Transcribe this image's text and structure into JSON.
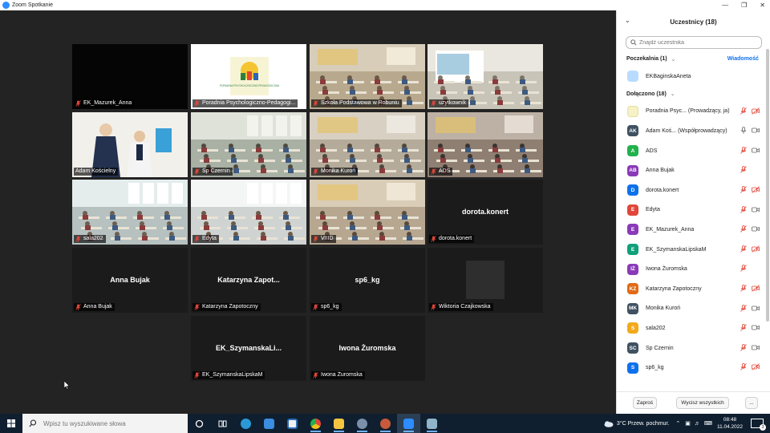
{
  "window": {
    "title": "Zoom Spotkanie"
  },
  "tiles": [
    {
      "name": "EK_Mazurek_Anna",
      "kind": "black"
    },
    {
      "name": "Poradnia Psychologiczno-Pedagogi...",
      "kind": "logo",
      "logo_text": "PORADNIA PSYCHOLOGICZNO-PEDAGOGICZNA"
    },
    {
      "name": "Szkoła Podstawowa w Robuniu",
      "kind": "classroom"
    },
    {
      "name": "użytkownik",
      "kind": "projector"
    },
    {
      "name": "Adam Kościelny",
      "kind": "speakers",
      "active": true
    },
    {
      "name": "Sp Czernin",
      "kind": "classroom2"
    },
    {
      "name": "Monika Kuroń",
      "kind": "classroom3"
    },
    {
      "name": "ADS",
      "kind": "classroom4"
    },
    {
      "name": "sala202",
      "kind": "classroom5"
    },
    {
      "name": "Edyta",
      "kind": "windows"
    },
    {
      "name": "VIIID",
      "kind": "classroom6"
    },
    {
      "name": "dorota.konert",
      "kind": "text",
      "big": "dorota.konert"
    },
    {
      "name": "Anna Bujak",
      "kind": "text",
      "big": "Anna Bujak"
    },
    {
      "name": "Katarzyna Zapotoczny",
      "kind": "text",
      "big": "Katarzyna  Zapot..."
    },
    {
      "name": "sp6_kg",
      "kind": "text",
      "big": "sp6_kg"
    },
    {
      "name": "Wiktoria Czajkowska",
      "kind": "avatar"
    },
    {
      "name": "EK_SzymanskaLipskaM",
      "kind": "text",
      "big": "EK_SzymanskaLi..."
    },
    {
      "name": "Iwona Żuromska",
      "kind": "text",
      "big": "Iwona Żuromska"
    }
  ],
  "panel": {
    "title": "Uczestnicy (18)",
    "search_placeholder": "Znajdź uczestnika",
    "waiting_label": "Poczekalnia (1)",
    "admit_label": "Wiadomość",
    "waiting": [
      {
        "name": "EKBaginskaAneta",
        "initials": "",
        "color": "#b9dbff"
      }
    ],
    "joined_label": "Dołączono (18)",
    "joined": [
      {
        "name": "Poradnia Psyc...  (Prowadzący, ja)",
        "initials": "",
        "color": "#f6f1c6",
        "mic": "muted",
        "cam": "off"
      },
      {
        "name": "Adam Koś...  (Współprowadzący)",
        "initials": "AK",
        "color": "#3f5162",
        "mic": "on",
        "cam": "on"
      },
      {
        "name": "ADS",
        "initials": "A",
        "color": "#22b14c",
        "mic": "muted",
        "cam": "on"
      },
      {
        "name": "Anna Bujak",
        "initials": "AB",
        "color": "#8a3ab9",
        "mic": "muted",
        "cam": "none"
      },
      {
        "name": "dorota.konert",
        "initials": "D",
        "color": "#0e71eb",
        "mic": "muted",
        "cam": "off"
      },
      {
        "name": "Edyta",
        "initials": "E",
        "color": "#e0463a",
        "mic": "muted",
        "cam": "on"
      },
      {
        "name": "EK_Mazurek_Anna",
        "initials": "E",
        "color": "#8a3ab9",
        "mic": "muted",
        "cam": "on"
      },
      {
        "name": "EK_SzymanskaLipskaM",
        "initials": "E",
        "color": "#10a07a",
        "mic": "muted",
        "cam": "off"
      },
      {
        "name": "Iwona Żuromska",
        "initials": "IŻ",
        "color": "#8a3ab9",
        "mic": "muted",
        "cam": "none"
      },
      {
        "name": "Katarzyna Zapotoczny",
        "initials": "KZ",
        "color": "#e06b16",
        "mic": "muted",
        "cam": "off"
      },
      {
        "name": "Monika Kuroń",
        "initials": "MK",
        "color": "#3f5162",
        "mic": "muted",
        "cam": "on"
      },
      {
        "name": "sala202",
        "initials": "S",
        "color": "#f2a91a",
        "mic": "muted",
        "cam": "on"
      },
      {
        "name": "Sp Czernin",
        "initials": "SC",
        "color": "#3f5162",
        "mic": "muted",
        "cam": "on"
      },
      {
        "name": "sp6_kg",
        "initials": "S",
        "color": "#0e71eb",
        "mic": "muted",
        "cam": "off"
      }
    ],
    "invite_label": "Zaproś",
    "mute_all_label": "Wycisz wszystkich",
    "more_label": "..."
  },
  "taskbar": {
    "search_placeholder": "Wpisz tu wyszukiwane słowa",
    "weather": "3°C  Przew. pochmur.",
    "time": "08:48",
    "date": "11.04.2022",
    "notifications": "3"
  },
  "colors": {
    "zoom_blue": "#2d8cff",
    "active_speaker": "#e6f25a",
    "muted_red": "#e0463a",
    "taskbar": "#0f1f30"
  }
}
